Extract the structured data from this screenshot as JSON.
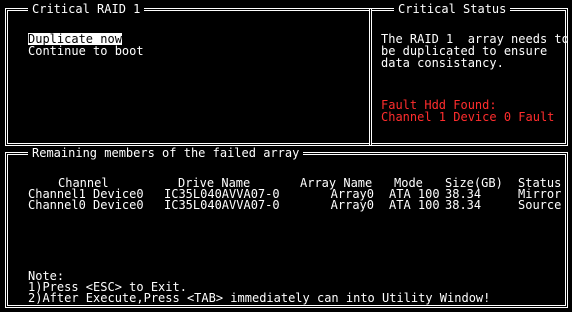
{
  "raid_panel": {
    "title": "Critical RAID 1",
    "options": [
      "Duplicate now",
      "Continue to boot"
    ],
    "selected_index": 0
  },
  "status_panel": {
    "title": "Critical Status",
    "message_lines": [
      "The RAID 1  array needs to",
      "be duplicated to ensure",
      "data consistancy."
    ],
    "fault_lines": [
      "Fault Hdd Found:",
      "Channel 1 Device 0 Fault"
    ],
    "fault_color": "#ff2d2d"
  },
  "members_panel": {
    "title": "Remaining members of the failed array",
    "headers": {
      "channel": "Channel",
      "drive_name": "Drive Name",
      "array_name": "Array Name",
      "mode": "Mode",
      "size": "Size(GB)",
      "status": "Status"
    },
    "rows": [
      {
        "channel": "Channel1 Device0",
        "drive_name": "IC35L040AVVA07-0",
        "array_name": "Array0",
        "mode": "ATA 100",
        "size": "38.34",
        "status": "Mirror"
      },
      {
        "channel": "Channel0 Device0",
        "drive_name": "IC35L040AVVA07-0",
        "array_name": "Array0",
        "mode": "ATA 100",
        "size": "38.34",
        "status": "Source"
      }
    ],
    "note_title": "Note:",
    "note_lines": [
      "1)Press <ESC> to Exit.",
      "2)After Execute,Press <TAB> immediately can into Utility Window!"
    ]
  }
}
